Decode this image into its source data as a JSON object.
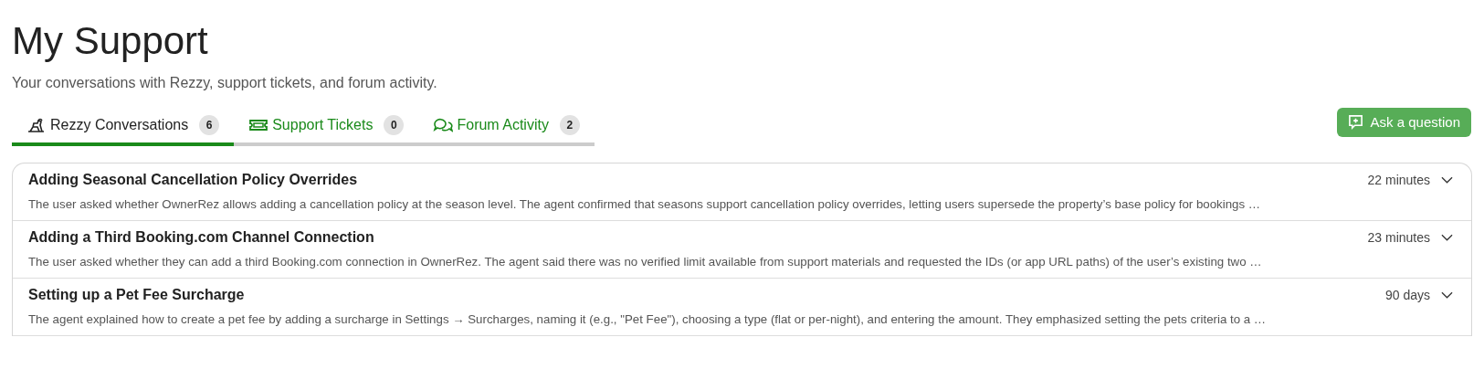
{
  "page": {
    "title": "My Support",
    "subtitle": "Your conversations with Rezzy, support tickets, and forum activity."
  },
  "tabs": [
    {
      "label": "Rezzy Conversations",
      "count": "6",
      "selected": true,
      "kind": "rezzy"
    },
    {
      "label": "Support Tickets",
      "count": "0",
      "selected": false,
      "kind": "ticket"
    },
    {
      "label": "Forum Activity",
      "count": "2",
      "selected": false,
      "kind": "forum"
    }
  ],
  "ask_button": {
    "label": "Ask a question"
  },
  "conversations": [
    {
      "title": "Adding Seasonal Cancellation Policy Overrides",
      "time": "22 minutes",
      "summary": "The user asked whether OwnerRez allows adding a cancellation policy at the season level. The agent confirmed that seasons support cancellation policy overrides, letting users supersede the property’s base policy for bookings …"
    },
    {
      "title": "Adding a Third Booking.com Channel Connection",
      "time": "23 minutes",
      "summary": "The user asked whether they can add a third Booking.com connection in OwnerRez. The agent said there was no verified limit available from support materials and requested the IDs (or app URL paths) of the user’s existing two …"
    },
    {
      "title": "Setting up a Pet Fee Surcharge",
      "time": "90 days",
      "summary": "The agent explained how to create a pet fee by adding a surcharge in Settings → Surcharges, naming it (e.g., \"Pet Fee\"), choosing a type (flat or per-night), and entering the amount. They emphasized setting the pets criteria to a …"
    }
  ]
}
